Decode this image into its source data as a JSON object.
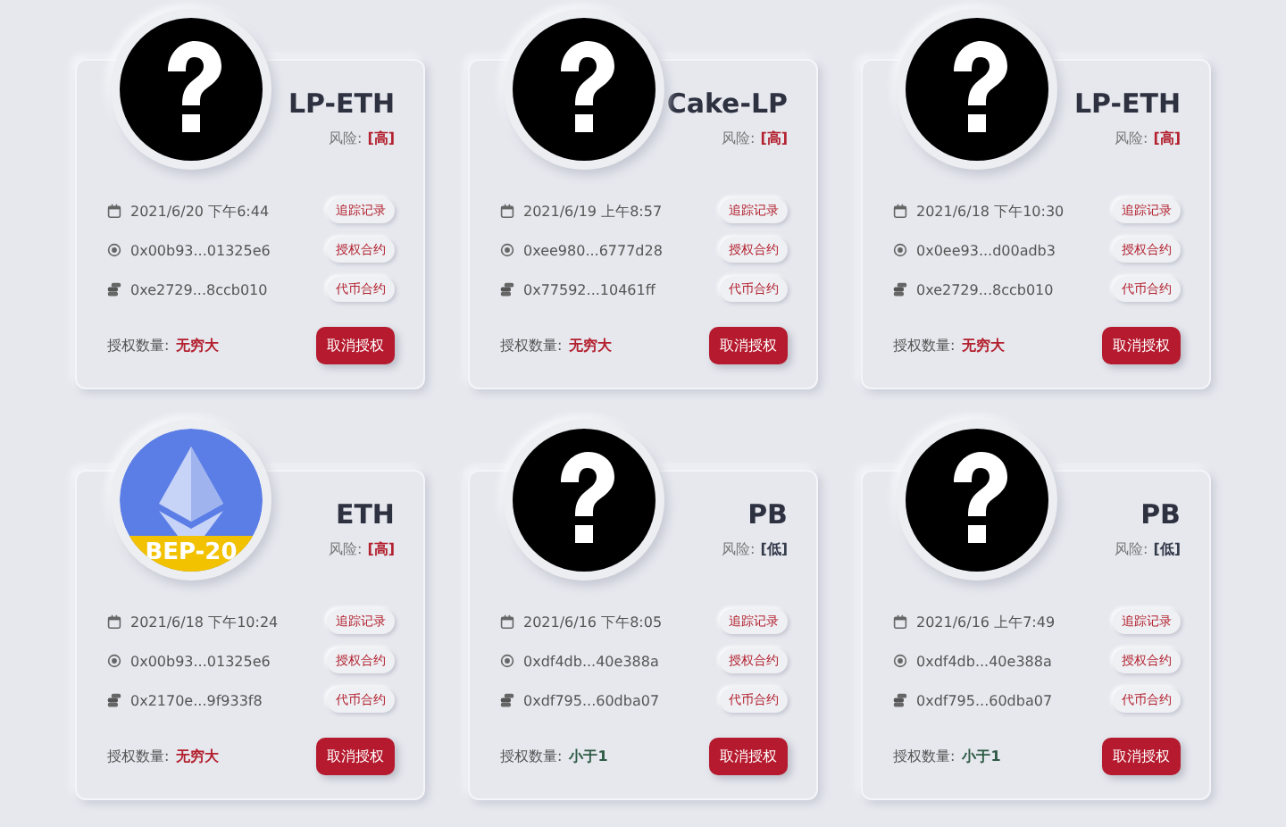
{
  "cards": [
    {
      "avatar": {
        "kind": "unknown"
      },
      "title": "LP-ETH",
      "risk_label": "风险:",
      "risk": {
        "kind": "high",
        "text": "[高]"
      },
      "rows": [
        {
          "kind": "date",
          "text": "2021/6/20 下午6:44",
          "tag": "追踪记录"
        },
        {
          "kind": "contract",
          "text": "0x00b93...01325e6",
          "tag": "授权合约"
        },
        {
          "kind": "token",
          "text": "0xe2729...8ccb010",
          "tag": "代币合约"
        }
      ],
      "amount_label": "授权数量:",
      "amount": {
        "kind": "unlimited",
        "text": "无穷大"
      },
      "button": "取消授权"
    },
    {
      "avatar": {
        "kind": "unknown"
      },
      "title": "Cake-LP",
      "risk_label": "风险:",
      "risk": {
        "kind": "high",
        "text": "[高]"
      },
      "rows": [
        {
          "kind": "date",
          "text": "2021/6/19 上午8:57",
          "tag": "追踪记录"
        },
        {
          "kind": "contract",
          "text": "0xee980...6777d28",
          "tag": "授权合约"
        },
        {
          "kind": "token",
          "text": "0x77592...10461ff",
          "tag": "代币合约"
        }
      ],
      "amount_label": "授权数量:",
      "amount": {
        "kind": "unlimited",
        "text": "无穷大"
      },
      "button": "取消授权"
    },
    {
      "avatar": {
        "kind": "unknown"
      },
      "title": "LP-ETH",
      "risk_label": "风险:",
      "risk": {
        "kind": "high",
        "text": "[高]"
      },
      "rows": [
        {
          "kind": "date",
          "text": "2021/6/18 下午10:30",
          "tag": "追踪记录"
        },
        {
          "kind": "contract",
          "text": "0x0ee93...d00adb3",
          "tag": "授权合约"
        },
        {
          "kind": "token",
          "text": "0xe2729...8ccb010",
          "tag": "代币合约"
        }
      ],
      "amount_label": "授权数量:",
      "amount": {
        "kind": "unlimited",
        "text": "无穷大"
      },
      "button": "取消授权"
    },
    {
      "avatar": {
        "kind": "eth",
        "badge": "BEP-20"
      },
      "title": "ETH",
      "risk_label": "风险:",
      "risk": {
        "kind": "high",
        "text": "[高]"
      },
      "rows": [
        {
          "kind": "date",
          "text": "2021/6/18 下午10:24",
          "tag": "追踪记录"
        },
        {
          "kind": "contract",
          "text": "0x00b93...01325e6",
          "tag": "授权合约"
        },
        {
          "kind": "token",
          "text": "0x2170e...9f933f8",
          "tag": "代币合约"
        }
      ],
      "amount_label": "授权数量:",
      "amount": {
        "kind": "unlimited",
        "text": "无穷大"
      },
      "button": "取消授权"
    },
    {
      "avatar": {
        "kind": "unknown"
      },
      "title": "PB",
      "risk_label": "风险:",
      "risk": {
        "kind": "low",
        "text": "[低]"
      },
      "rows": [
        {
          "kind": "date",
          "text": "2021/6/16 下午8:05",
          "tag": "追踪记录"
        },
        {
          "kind": "contract",
          "text": "0xdf4db...40e388a",
          "tag": "授权合约"
        },
        {
          "kind": "token",
          "text": "0xdf795...60dba07",
          "tag": "代币合约"
        }
      ],
      "amount_label": "授权数量:",
      "amount": {
        "kind": "limited",
        "text": "小于1"
      },
      "button": "取消授权"
    },
    {
      "avatar": {
        "kind": "unknown"
      },
      "title": "PB",
      "risk_label": "风险:",
      "risk": {
        "kind": "low",
        "text": "[低]"
      },
      "rows": [
        {
          "kind": "date",
          "text": "2021/6/16 上午7:49",
          "tag": "追踪记录"
        },
        {
          "kind": "contract",
          "text": "0xdf4db...40e388a",
          "tag": "授权合约"
        },
        {
          "kind": "token",
          "text": "0xdf795...60dba07",
          "tag": "代币合约"
        }
      ],
      "amount_label": "授权数量:",
      "amount": {
        "kind": "limited",
        "text": "小于1"
      },
      "button": "取消授权"
    }
  ]
}
